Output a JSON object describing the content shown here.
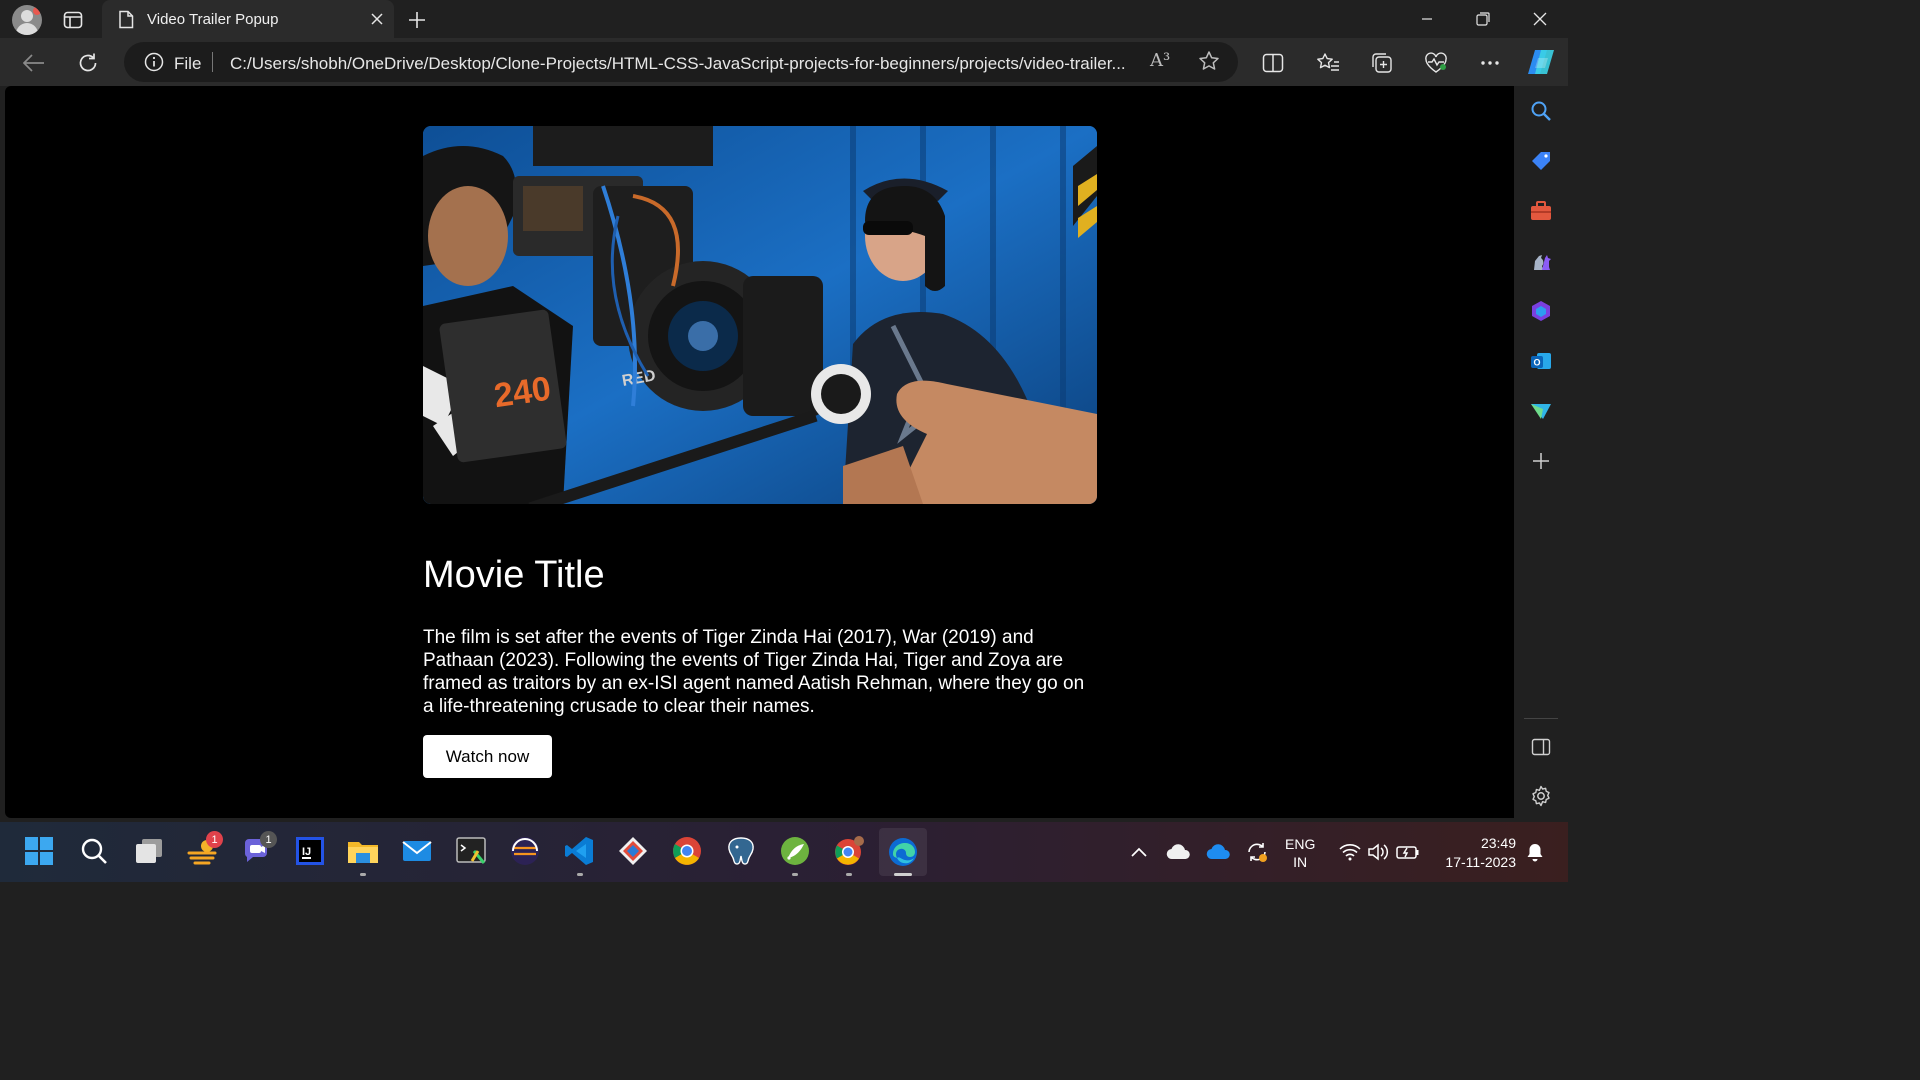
{
  "browser": {
    "tab": {
      "title": "Video Trailer Popup"
    },
    "address_bar": {
      "scheme_label": "File",
      "url": "C:/Users/shobh/OneDrive/Desktop/Clone-Projects/HTML-CSS-JavaScript-projects-for-beginners/projects/video-trailer...",
      "read_aloud_label": "A³"
    }
  },
  "page": {
    "title": "Movie Title",
    "description": "The film is set after the events of Tiger Zinda Hai (2017), War (2019) and Pathaan (2023). Following the events of Tiger Zinda Hai, Tiger and Zoya are framed as traitors by an ex-ISI agent named Aatish Rehman, where they go on a life-threatening crusade to clear their names.",
    "button_label": "Watch now",
    "hero_camera_text": {
      "battery_number": "240",
      "brand": "RED"
    }
  },
  "taskbar": {
    "badges": {
      "widgets": "1",
      "teams": "1"
    },
    "language": {
      "line1": "ENG",
      "line2": "IN"
    },
    "clock": {
      "time": "23:49",
      "date": "17-11-2023"
    }
  },
  "colors": {
    "accent_edge": "#0078d4",
    "badge_red": "#e0424b",
    "page_bg": "#000000"
  }
}
